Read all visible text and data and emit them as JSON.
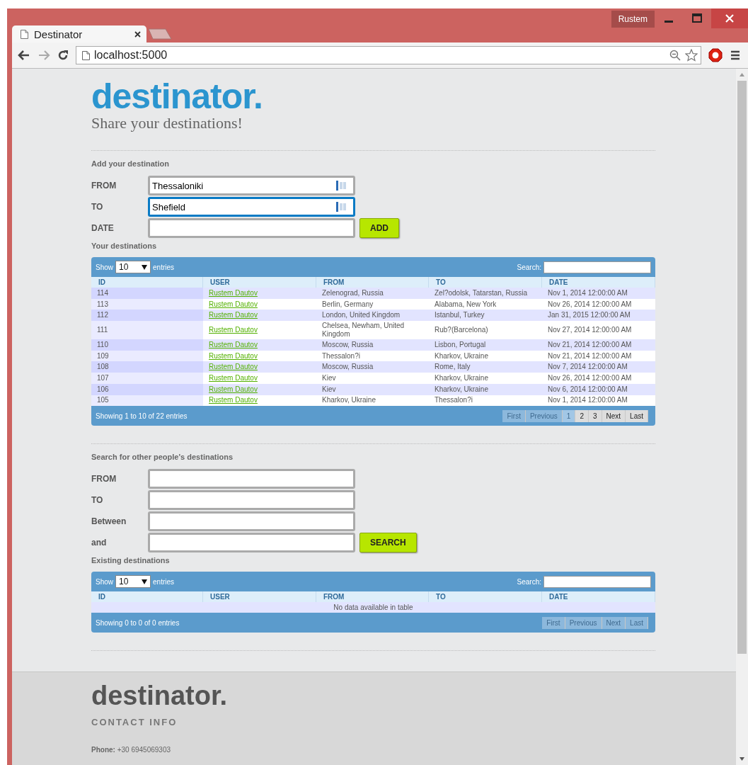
{
  "browser": {
    "tab_title": "Destinator",
    "profile": "Rustem",
    "address": "localhost:5000"
  },
  "header": {
    "logo": "destinator.",
    "tagline": "Share your destinations!"
  },
  "add_form": {
    "heading": "Add your destination",
    "fields": [
      {
        "label": "FROM",
        "value": "Thessaloniki",
        "focused": false
      },
      {
        "label": "TO",
        "value": "Shefield",
        "focused": true
      },
      {
        "label": "DATE",
        "focused": false
      }
    ],
    "button": "ADD"
  },
  "your_destinations": {
    "heading": "Your destinations",
    "table": {
      "show_label": "Show",
      "length": "10",
      "entries_label": "entries",
      "search_label": "Search:",
      "columns": [
        "ID",
        "USER",
        "FROM",
        "TO",
        "DATE"
      ],
      "rows": [
        {
          "id": "114",
          "user": "Rustem Dautov",
          "from": "Zelenograd, Russia",
          "to": "Zel?odolsk, Tatarstan, Russia",
          "date": "Nov 1, 2014 12:00:00 AM"
        },
        {
          "id": "113",
          "user": "Rustem Dautov",
          "from": "Berlin, Germany",
          "to": "Alabama, New York",
          "date": "Nov 26, 2014 12:00:00 AM"
        },
        {
          "id": "112",
          "user": "Rustem Dautov",
          "from": "London, United Kingdom",
          "to": "Istanbul, Turkey",
          "date": "Jan 31, 2015 12:00:00 AM"
        },
        {
          "id": "111",
          "user": "Rustem Dautov",
          "from": "Chelsea, Newham, United Kingdom",
          "to": "Rub?(Barcelona)",
          "date": "Nov 27, 2014 12:00:00 AM"
        },
        {
          "id": "110",
          "user": "Rustem Dautov",
          "from": "Moscow, Russia",
          "to": "Lisbon, Portugal",
          "date": "Nov 21, 2014 12:00:00 AM"
        },
        {
          "id": "109",
          "user": "Rustem Dautov",
          "from": "Thessalon?i",
          "to": "Kharkov, Ukraine",
          "date": "Nov 21, 2014 12:00:00 AM"
        },
        {
          "id": "108",
          "user": "Rustem Dautov",
          "from": "Moscow, Russia",
          "to": "Rome, Italy",
          "date": "Nov 7, 2014 12:00:00 AM"
        },
        {
          "id": "107",
          "user": "Rustem Dautov",
          "from": "Kiev",
          "to": "Kharkov, Ukraine",
          "date": "Nov 26, 2014 12:00:00 AM"
        },
        {
          "id": "106",
          "user": "Rustem Dautov",
          "from": "Kiev",
          "to": "Kharkov, Ukraine",
          "date": "Nov 6, 2014 12:00:00 AM"
        },
        {
          "id": "105",
          "user": "Rustem Dautov",
          "from": "Kharkov, Ukraine",
          "to": "Thessalon?i",
          "date": "Nov 1, 2014 12:00:00 AM"
        }
      ],
      "info": "Showing 1 to 10 of 22 entries",
      "pages": [
        {
          "label": "First",
          "disabled": true,
          "selected": false
        },
        {
          "label": "Previous",
          "disabled": true,
          "selected": false
        },
        {
          "label": "1",
          "disabled": false,
          "selected": true
        },
        {
          "label": "2",
          "disabled": false,
          "selected": false
        },
        {
          "label": "3",
          "disabled": false,
          "selected": false
        },
        {
          "label": "Next",
          "disabled": false,
          "selected": false
        },
        {
          "label": "Last",
          "disabled": false,
          "selected": false
        }
      ]
    }
  },
  "search_form": {
    "heading": "Search for other people's destinations",
    "fields": [
      {
        "label": "FROM",
        "focused": false
      },
      {
        "label": "TO",
        "focused": false
      },
      {
        "label": "Between",
        "focused": false
      },
      {
        "label": "and",
        "focused": false
      }
    ],
    "button": "SEARCH"
  },
  "existing_destinations": {
    "heading": "Existing destinations",
    "table": {
      "show_label": "Show",
      "length": "10",
      "entries_label": "entries",
      "search_label": "Search:",
      "columns": [
        "ID",
        "USER",
        "FROM",
        "TO",
        "DATE"
      ],
      "empty_message": "No data available in table",
      "info": "Showing 0 to 0 of 0 entries",
      "pages": [
        {
          "label": "First",
          "disabled": true,
          "selected": false
        },
        {
          "label": "Previous",
          "disabled": true,
          "selected": false
        },
        {
          "label": "Next",
          "disabled": true,
          "selected": false
        },
        {
          "label": "Last",
          "disabled": true,
          "selected": false
        }
      ]
    }
  },
  "footer": {
    "logo": "destinator.",
    "contact_heading": "CONTACT INFO",
    "phone": "**Phone:** +30 6945069303"
  }
}
